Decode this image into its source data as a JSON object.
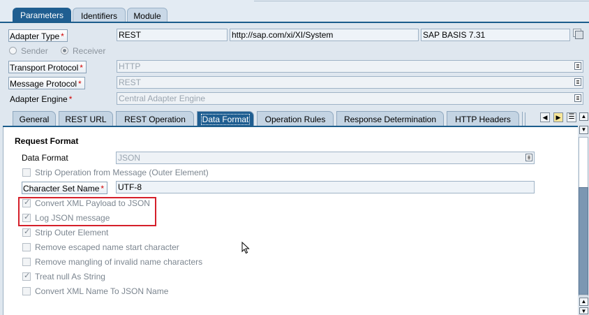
{
  "top_tabs": [
    {
      "label": "Parameters",
      "active": true
    },
    {
      "label": "Identifiers",
      "active": false
    },
    {
      "label": "Module",
      "active": false
    }
  ],
  "header": {
    "adapter_type": {
      "label": "Adapter Type",
      "required": "*",
      "value": "REST",
      "namespace": "http://sap.com/xi/XI/System",
      "software_component": "SAP BASIS 7.31"
    },
    "sender_label": "Sender",
    "receiver_label": "Receiver",
    "selected_direction": "Receiver",
    "transport_protocol": {
      "label": "Transport Protocol",
      "required": "*",
      "value": "HTTP"
    },
    "message_protocol": {
      "label": "Message Protocol",
      "required": "*",
      "value": "REST"
    },
    "adapter_engine": {
      "label": "Adapter Engine",
      "required": "*",
      "value": "Central Adapter Engine"
    }
  },
  "sub_tabs": [
    {
      "label": "General",
      "active": false
    },
    {
      "label": "REST URL",
      "active": false
    },
    {
      "label": "REST Operation",
      "active": false
    },
    {
      "label": "Data Format",
      "active": true
    },
    {
      "label": "Operation Rules",
      "active": false
    },
    {
      "label": "Response Determination",
      "active": false
    },
    {
      "label": "HTTP Headers",
      "active": false
    }
  ],
  "content": {
    "section_title": "Request Format",
    "data_format": {
      "label": "Data Format",
      "value": "JSON"
    },
    "charset": {
      "label": "Character Set Name",
      "required": "*",
      "value": "UTF-8"
    },
    "checkboxes": [
      {
        "label": "Strip Operation from Message (Outer Element)",
        "checked": false
      },
      {
        "label": "Convert XML Payload to JSON",
        "checked": true
      },
      {
        "label": "Log JSON message",
        "checked": true
      },
      {
        "label": "Strip Outer Element",
        "checked": true
      },
      {
        "label": "Remove escaped name start character",
        "checked": false
      },
      {
        "label": "Remove mangling of invalid name characters",
        "checked": false
      },
      {
        "label": "Treat null As String",
        "checked": true
      },
      {
        "label": "Convert XML Name To JSON Name",
        "checked": false
      }
    ]
  },
  "colors": {
    "accent": "#1f5e91",
    "highlight": "#d51f2a",
    "required": "#d00000"
  }
}
